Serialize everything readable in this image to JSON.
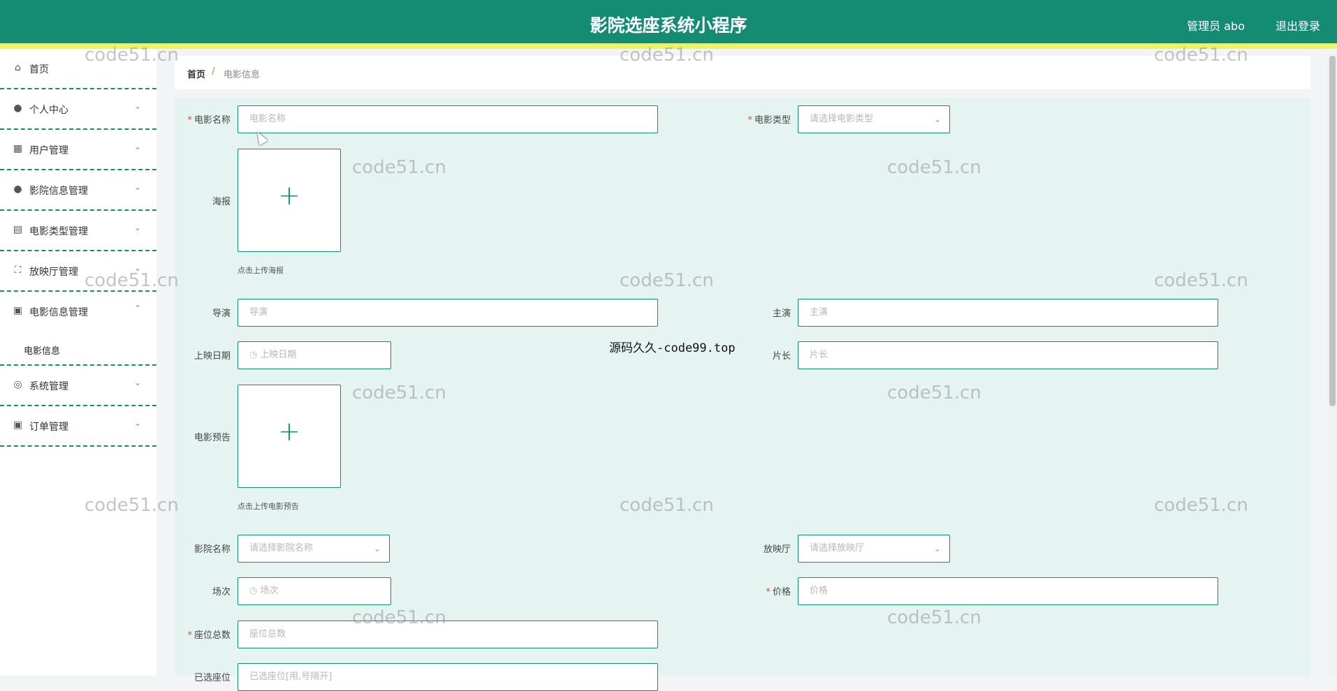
{
  "header": {
    "title": "影院选座系统小程序",
    "user": "管理员 abo",
    "logout": "退出登录"
  },
  "sidebar": {
    "items": [
      {
        "label": "首页",
        "icon": "home-icon"
      },
      {
        "label": "个人中心",
        "icon": "user-icon"
      },
      {
        "label": "用户管理",
        "icon": "chart-icon"
      },
      {
        "label": "影院信息管理",
        "icon": "user-icon"
      },
      {
        "label": "电影类型管理",
        "icon": "grid-icon"
      },
      {
        "label": "放映厅管理",
        "icon": "fullscreen-icon"
      },
      {
        "label": "电影信息管理",
        "icon": "briefcase-icon"
      },
      {
        "label": "系统管理",
        "icon": "settings-icon"
      },
      {
        "label": "订单管理",
        "icon": "briefcase-icon"
      }
    ],
    "submenu": "电影信息"
  },
  "breadcrumb": {
    "home": "首页",
    "separator": "/",
    "current": "电影信息"
  },
  "form": {
    "movie_name_label": "电影名称",
    "movie_name_placeholder": "电影名称",
    "movie_type_label": "电影类型",
    "movie_type_placeholder": "请选择电影类型",
    "poster_label": "海报",
    "poster_hint": "点击上传海报",
    "director_label": "导演",
    "director_placeholder": "导演",
    "actor_label": "主演",
    "actor_placeholder": "主演",
    "release_label": "上映日期",
    "release_placeholder": "上映日期",
    "duration_label": "片长",
    "duration_placeholder": "片长",
    "trailer_label": "电影预告",
    "trailer_hint": "点击上传电影预告",
    "cinema_label": "影院名称",
    "cinema_placeholder": "请选择影院名称",
    "hall_label": "放映厅",
    "hall_placeholder": "请选择放映厅",
    "session_label": "场次",
    "session_placeholder": "场次",
    "price_label": "价格",
    "price_placeholder": "价格",
    "seats_label": "座位总数",
    "seats_placeholder": "座位总数",
    "selected_label": "已选座位",
    "selected_placeholder": "已选座位[用,号隔开]"
  },
  "watermarks": {
    "text": "code51.cn",
    "center": "源码久久-code99.top"
  },
  "colors": {
    "primary": "#138c73",
    "accent_strip": "#eef26b",
    "form_bg": "#e5f4f1"
  }
}
